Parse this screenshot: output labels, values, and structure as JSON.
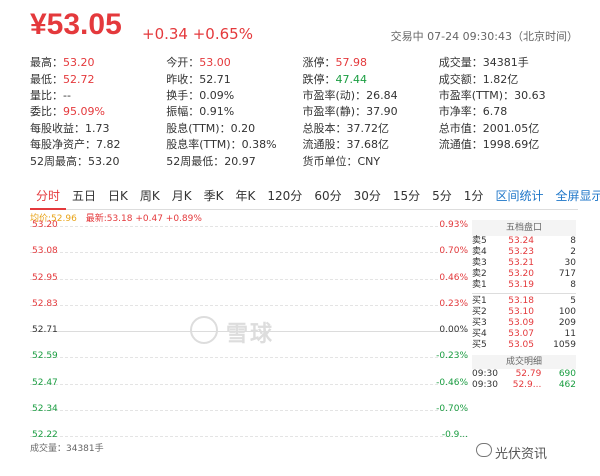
{
  "quote": {
    "price": "¥53.05",
    "change": "+0.34 +0.65%",
    "status": "交易中 07-24 09:30:43（北京时间）"
  },
  "stats": [
    [
      {
        "k": "最高：",
        "v": "53.20",
        "c": "red"
      },
      {
        "k": "今开：",
        "v": "53.00",
        "c": "red"
      },
      {
        "k": "涨停：",
        "v": "57.98",
        "c": "red"
      },
      {
        "k": "成交量：",
        "v": "34381手",
        "c": ""
      }
    ],
    [
      {
        "k": "最低：",
        "v": "52.72",
        "c": "red"
      },
      {
        "k": "昨收：",
        "v": "52.71",
        "c": ""
      },
      {
        "k": "跌停：",
        "v": "47.44",
        "c": "green"
      },
      {
        "k": "成交额：",
        "v": "1.82亿",
        "c": ""
      }
    ],
    [
      {
        "k": "量比：",
        "v": "--",
        "c": ""
      },
      {
        "k": "换手：",
        "v": "0.09%",
        "c": ""
      },
      {
        "k": "市盈率(动)：",
        "v": "26.84",
        "c": ""
      },
      {
        "k": "市盈率(TTM)：",
        "v": "30.63",
        "c": ""
      }
    ],
    [
      {
        "k": "委比：",
        "v": "95.09%",
        "c": "red"
      },
      {
        "k": "振幅：",
        "v": "0.91%",
        "c": ""
      },
      {
        "k": "市盈率(静)：",
        "v": "37.90",
        "c": ""
      },
      {
        "k": "市净率：",
        "v": "6.78",
        "c": ""
      }
    ],
    [
      {
        "k": "每股收益：",
        "v": "1.73",
        "c": ""
      },
      {
        "k": "股息(TTM)：",
        "v": "0.20",
        "c": ""
      },
      {
        "k": "总股本：",
        "v": "37.72亿",
        "c": ""
      },
      {
        "k": "总市值：",
        "v": "2001.05亿",
        "c": ""
      }
    ],
    [
      {
        "k": "每股净资产：",
        "v": "7.82",
        "c": ""
      },
      {
        "k": "股息率(TTM)：",
        "v": "0.38%",
        "c": ""
      },
      {
        "k": "流通股：",
        "v": "37.68亿",
        "c": ""
      },
      {
        "k": "流通值：",
        "v": "1998.69亿",
        "c": ""
      }
    ],
    [
      {
        "k": "52周最高：",
        "v": "53.20",
        "c": ""
      },
      {
        "k": "52周最低：",
        "v": "20.97",
        "c": ""
      },
      {
        "k": "货币单位：",
        "v": "CNY",
        "c": ""
      },
      {
        "k": "",
        "v": "",
        "c": ""
      }
    ]
  ],
  "tabs": [
    "分时",
    "五日",
    "日K",
    "周K",
    "月K",
    "季K",
    "年K",
    "120分",
    "60分",
    "30分",
    "15分",
    "5分",
    "1分"
  ],
  "tabs_right": [
    "区间统计",
    "全屏显示"
  ],
  "legend": {
    "avg": "均价:52.96",
    "latest": "最新:53.18 +0.47 +0.89%"
  },
  "chart": {
    "y_labels": [
      "53.20",
      "53.08",
      "52.95",
      "52.83",
      "52.71",
      "52.59",
      "52.47",
      "52.34",
      "52.22"
    ],
    "pct_labels": [
      "0.93%",
      "0.70%",
      "0.46%",
      "0.23%",
      "0.00%",
      "-0.23%",
      "-0.46%",
      "-0.70%",
      "-0.9..."
    ],
    "watermark": "雪球",
    "volume": "成交量：34381手"
  },
  "orderbook": {
    "title": "五档盘口",
    "asks": [
      {
        "lbl": "卖5",
        "p": "53.24",
        "v": "8"
      },
      {
        "lbl": "卖4",
        "p": "53.23",
        "v": "2"
      },
      {
        "lbl": "卖3",
        "p": "53.21",
        "v": "30"
      },
      {
        "lbl": "卖2",
        "p": "53.20",
        "v": "717"
      },
      {
        "lbl": "卖1",
        "p": "53.19",
        "v": "8"
      }
    ],
    "bids": [
      {
        "lbl": "买1",
        "p": "53.18",
        "v": "5"
      },
      {
        "lbl": "买2",
        "p": "53.10",
        "v": "100"
      },
      {
        "lbl": "买3",
        "p": "53.09",
        "v": "209"
      },
      {
        "lbl": "买4",
        "p": "53.07",
        "v": "11"
      },
      {
        "lbl": "买5",
        "p": "53.05",
        "v": "1059"
      }
    ]
  },
  "trades": {
    "title": "成交明细",
    "rows": [
      {
        "t": "09:30",
        "p": "52.79",
        "v": "690"
      },
      {
        "t": "09:30",
        "p": "52.9...",
        "v": "462"
      }
    ]
  },
  "signature": "光伏资讯",
  "colors": {
    "up": "#e4393c",
    "down": "#1a9d41",
    "link": "#1e76c8"
  }
}
